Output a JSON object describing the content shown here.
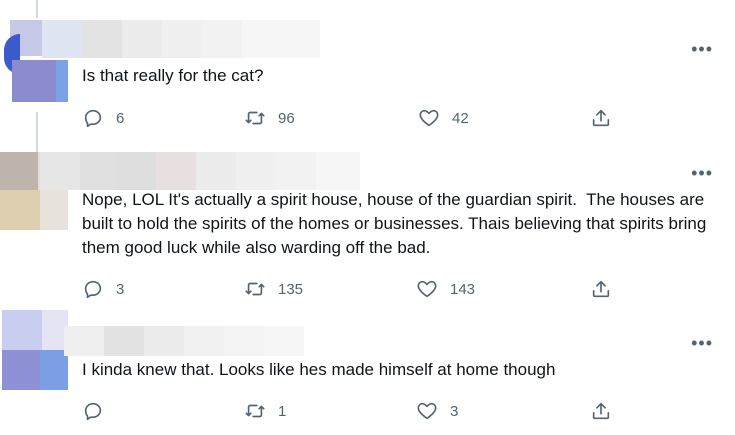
{
  "tweets": [
    {
      "text": "Is that really for the cat?",
      "replies": "6",
      "retweets": "96",
      "likes": "42"
    },
    {
      "text": "Nope, LOL It's actually a spirit house, house of the guardian spirit.  The houses are built to hold the spirits of the homes or businesses. Thais believing that spirits bring them good luck while also warding off the bad.",
      "replies": "3",
      "retweets": "135",
      "likes": "143"
    },
    {
      "text": "I kinda knew that. Looks like hes made himself at home though",
      "replies": "",
      "retweets": "1",
      "likes": "3"
    }
  ],
  "icons": {
    "reply": "reply-icon",
    "retweet": "retweet-icon",
    "like": "heart-icon",
    "share": "share-icon",
    "more": "more-icon"
  },
  "colors": {
    "icon_gray": "#536471",
    "text": "#0f1419",
    "thread_line": "#cfd9de"
  }
}
